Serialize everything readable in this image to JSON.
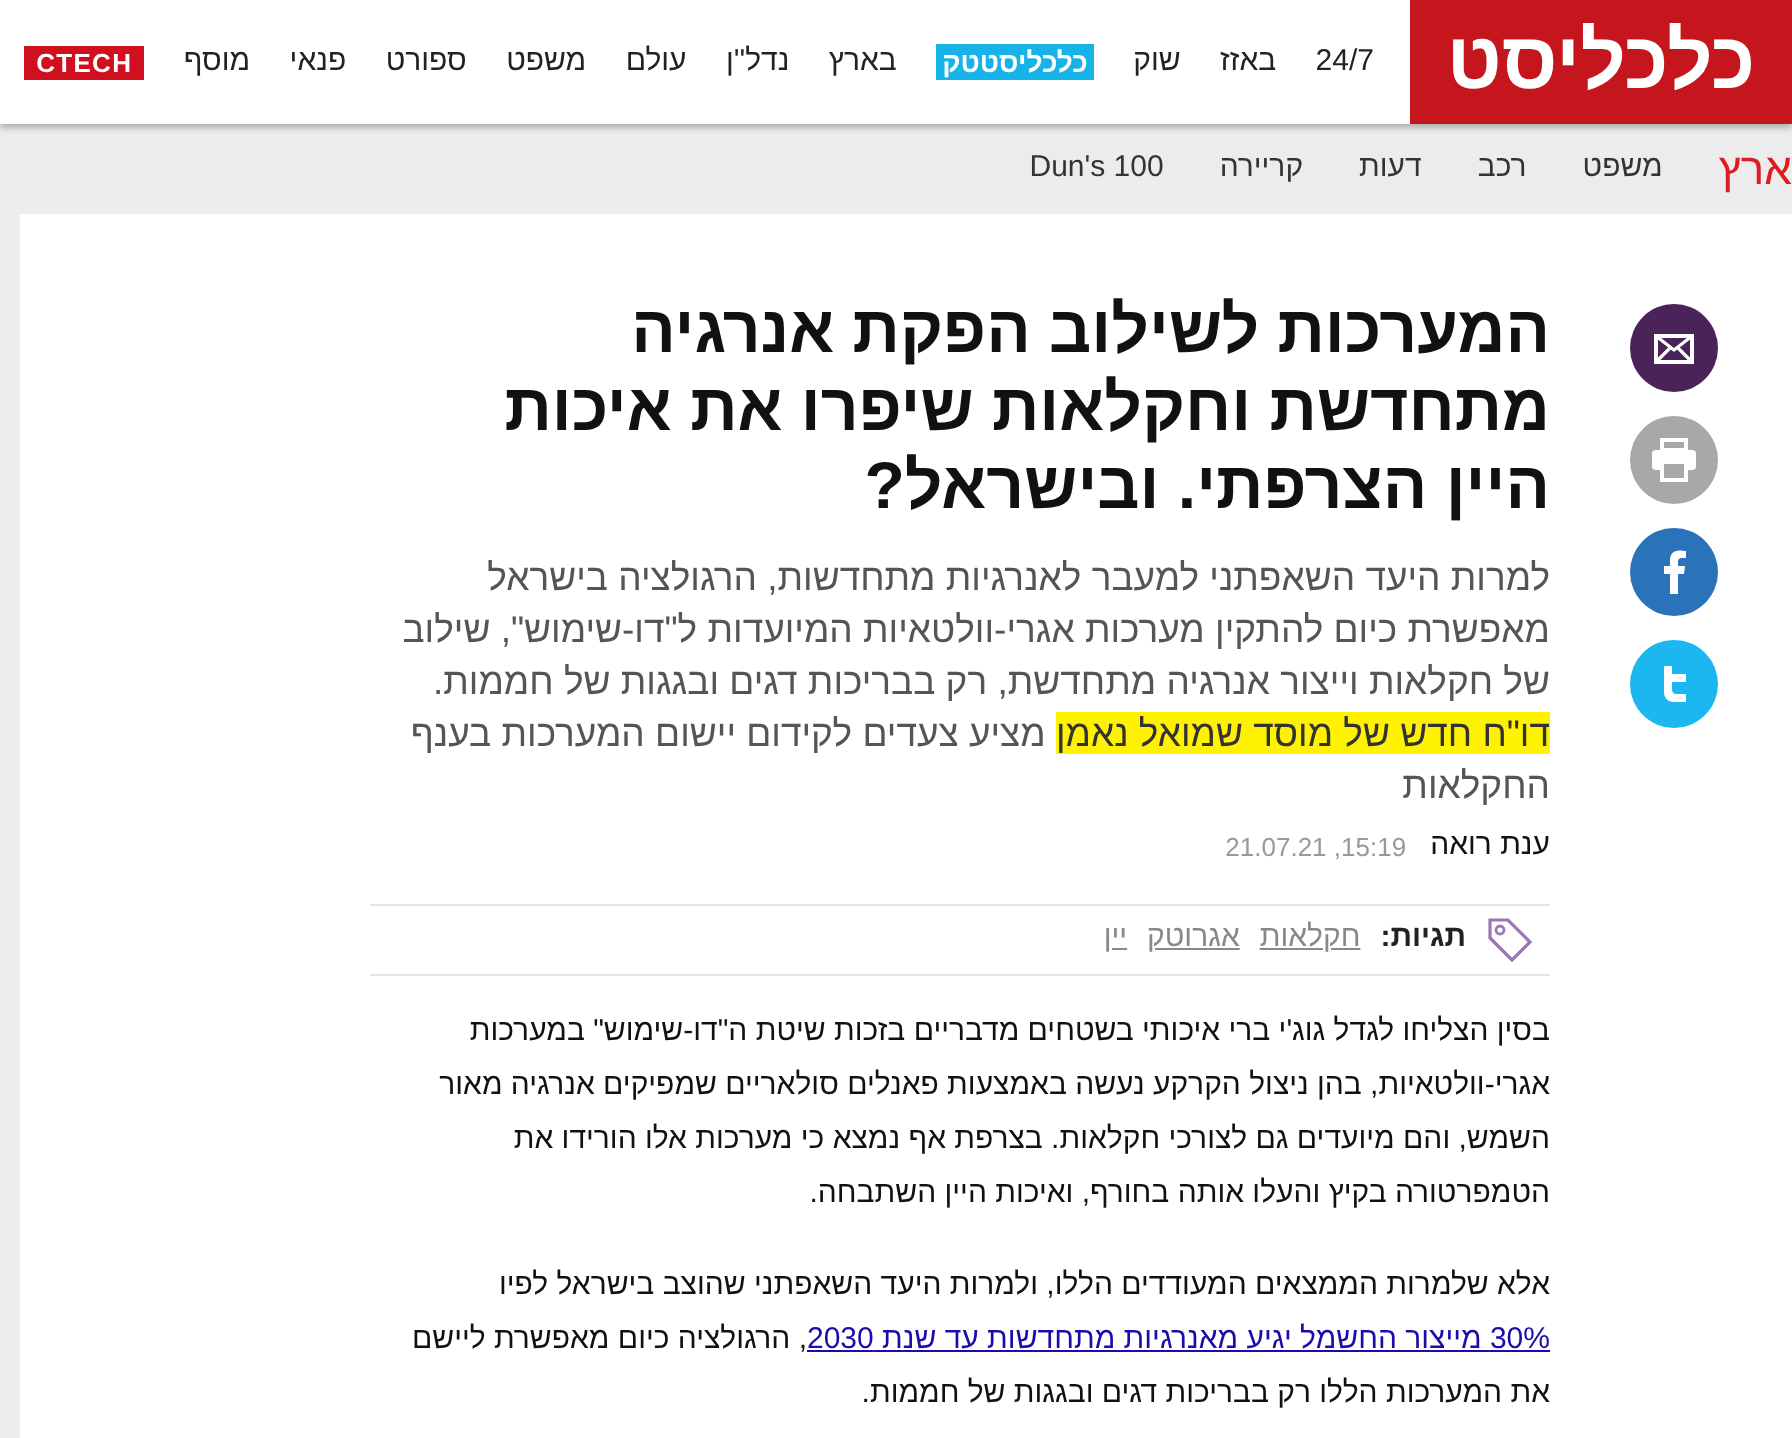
{
  "header": {
    "logo": "כלכליסט",
    "nav": [
      {
        "label": "24/7",
        "kind": "link"
      },
      {
        "label": "באזז",
        "kind": "link"
      },
      {
        "label": "שוק",
        "kind": "link"
      },
      {
        "label": "כלכליסטטק",
        "kind": "badge"
      },
      {
        "label": "בארץ",
        "kind": "link"
      },
      {
        "label": "נדל''ן",
        "kind": "link"
      },
      {
        "label": "עולם",
        "kind": "link"
      },
      {
        "label": "משפט",
        "kind": "link"
      },
      {
        "label": "ספורט",
        "kind": "link"
      },
      {
        "label": "פנאי",
        "kind": "link"
      },
      {
        "label": "מוסף",
        "kind": "link"
      },
      {
        "label": "CTECH",
        "kind": "brand"
      }
    ]
  },
  "subnav": {
    "section": "ארץ",
    "items": [
      "משפט",
      "רכב",
      "דעות",
      "קריירה",
      "Dun's 100"
    ]
  },
  "share": [
    {
      "kind": "mail"
    },
    {
      "kind": "print"
    },
    {
      "kind": "facebook"
    },
    {
      "kind": "twitter"
    }
  ],
  "article": {
    "title": "המערכות לשילוב הפקת אנרגיה מתחדשת וחקלאות שיפרו את איכות היין הצרפתי. ובישראל?",
    "summary": {
      "before": "למרות היעד השאפתני למעבר לאנרגיות מתחדשות, הרגולציה בישראל מאפשרת כיום להתקין מערכות אגרי-וולטאיות המיועדות ל\"דו-שימוש\", שילוב של חקלאות וייצור אנרגיה מתחדשת, רק בבריכות דגים ובגגות של חממות.",
      "highlighted": "דו\"ח חדש של מוסד שמואל נאמן",
      "after": "מציע צעדים לקידום יישום המערכות בענף החקלאות"
    },
    "author": "ענת רואה",
    "date": "15:19, 21.07.21",
    "tags_label": "תגיות:",
    "tags": [
      "חקלאות",
      "אגרוטק",
      "יין"
    ],
    "paragraphs": [
      {
        "before": "בסין הצליחו לגדל גוג'י ברי איכותי בשטחים מדבריים בזכות שיטת ה\"דו-שימוש\" במערכות אגרי-וולטאיות, בהן ניצול הקרקע נעשה באמצעות פאנלים סולאריים שמפיקים אנרגיה מאור השמש, והם מיועדים גם לצורכי חקלאות. בצרפת אף נמצא כי מערכות אלו הורידו את הטמפרטורה בקיץ והעלו אותה בחורף, ואיכות היין השתבחה."
      },
      {
        "before": "אלא שלמרות הממצאים המעודדים הללו, ולמרות היעד השאפתני שהוצב בישראל לפיו ",
        "link": "30% מייצור החשמל יגיע מאנרגיות מתחדשות עד שנת 2030",
        "after": ", הרגולציה כיום מאפשרת ליישם את המערכות הללו רק בבריכות דגים ובגגות של חממות."
      }
    ]
  }
}
